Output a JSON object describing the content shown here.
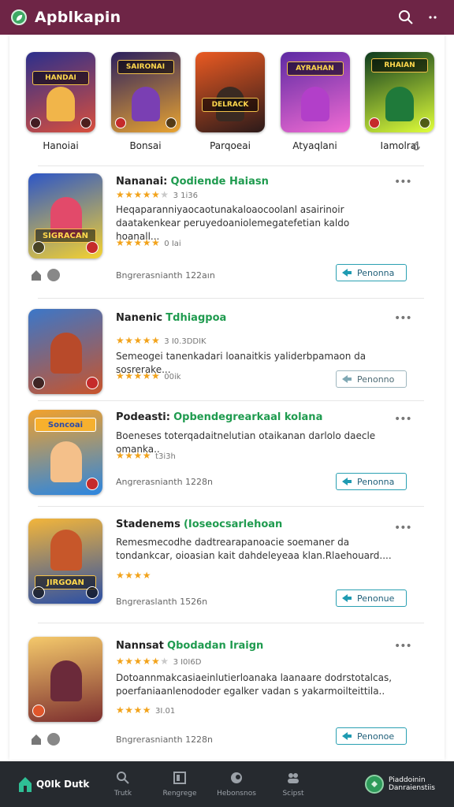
{
  "header": {
    "title": "Apblkapin",
    "logo_icon": "leaf-icon",
    "search_icon": "search-icon",
    "menu_icon": "more-vertical-icon",
    "bg_color": "#6e2546"
  },
  "featured": [
    {
      "label": "Hanoiai",
      "art_text": "HANDAI",
      "colors": [
        "#2b2f8c",
        "#d94f3d"
      ]
    },
    {
      "label": "Bonsai",
      "art_text": "SAIRONAI",
      "colors": [
        "#2a1f5e",
        "#e9a431"
      ]
    },
    {
      "label": "Parqoeai",
      "art_text": "DELRACK",
      "colors": [
        "#ea5a22",
        "#2b1a1a"
      ]
    },
    {
      "label": "Atyaqlani",
      "art_text": "AYRAHAN",
      "colors": [
        "#5d2aa3",
        "#f06bd3"
      ]
    },
    {
      "label": "Iamolrai",
      "art_text": "RHAIAN",
      "colors": [
        "#0d3a1e",
        "#e0ff3a"
      ]
    }
  ],
  "apps": [
    {
      "name": "Nananai:",
      "tag": "Qodiende Haiasn",
      "rating_top": "★★★★★",
      "rating_top_off": "★",
      "rating_top_meta": "3 1i36",
      "description": "Heqaparanniyaocaotunakaloaocoolanl asairinoir daatakenkear peruyedoaniolemegatefetian kaldo hoanall...",
      "rating_bottom": "★★★★★",
      "rating_bottom_meta": "0 Iai",
      "footer": "Bngrerasnianth 122aın",
      "install": "Penonna",
      "art_text": "SIGRACAN",
      "colors": [
        "#2d56c7",
        "#f5d230"
      ]
    },
    {
      "name": "Nanenic",
      "tag": "Tdhiagpoa",
      "rating_top": "★★★★★",
      "rating_top_off": "",
      "rating_top_meta": "3 I0.3DDIK",
      "description": "Semeogei tanenkadari loanaitkis yaliderbpamaon da sosrerake...",
      "rating_bottom": "★★★★★",
      "rating_bottom_meta": "00ik",
      "footer": "",
      "install": "Penonno",
      "art_text": "",
      "colors": [
        "#3b77c9",
        "#c9542b"
      ]
    },
    {
      "name": "Podeasti:",
      "tag": "Opbendegrearkaal kolana",
      "rating_top": "",
      "rating_top_off": "",
      "rating_top_meta": "",
      "description": "Boeneses toterqadaitnelutian otaikanan darlolo daecle omanka..",
      "rating_bottom": "★★★★",
      "rating_bottom_meta": "t3i3h",
      "footer": "Angrerasnianth 1228n",
      "install": "Penonna",
      "art_text": "Soncoai",
      "colors": [
        "#f2a12b",
        "#2c86e0"
      ]
    },
    {
      "name": "Stadenems",
      "tag": "(Ioseocsarlehoan",
      "rating_top": "",
      "rating_top_off": "",
      "rating_top_meta": "",
      "description": "Remesmecodhe dadtrearapanoacie soemaner da tondankcar, oioasian kait dahdeleyeaa klan.Rlaehouard....",
      "rating_bottom": "★★★★",
      "rating_bottom_meta": "",
      "footer": "Bngreraslanth 1526n",
      "install": "Penonue",
      "art_text": "JIRGOAN",
      "colors": [
        "#f2b53b",
        "#2a4fa6"
      ]
    },
    {
      "name": "Nannsat",
      "tag": "Qbodadan Iraign",
      "rating_top": "★★★★★",
      "rating_top_off": "★",
      "rating_top_meta": "3 I0I6D",
      "description": "Dotoannmakcasiaeinlutierloanaka laanaare dodrstotalcas, poerfaniaanlenododer egalker vadan s yakarmoilteittila..",
      "rating_bottom": "★★★★",
      "rating_bottom_meta": "3I.01",
      "footer": "Bngrerasnianth 1228n",
      "install": "Penonoe",
      "art_text": "",
      "colors": [
        "#f4c96b",
        "#7d2f2f"
      ]
    }
  ],
  "bottom_nav": {
    "brand": "Q0Ik Dutk",
    "items": [
      {
        "icon": "search-icon",
        "label": "Trutk"
      },
      {
        "icon": "library-icon",
        "label": "Rengrege"
      },
      {
        "icon": "discover-icon",
        "label": "Hebonsnos"
      },
      {
        "icon": "people-icon",
        "label": "Scipst"
      }
    ],
    "account_line1": "Piaddoinin",
    "account_line2": "Danraienstiis",
    "bg_color": "#262a2f"
  }
}
